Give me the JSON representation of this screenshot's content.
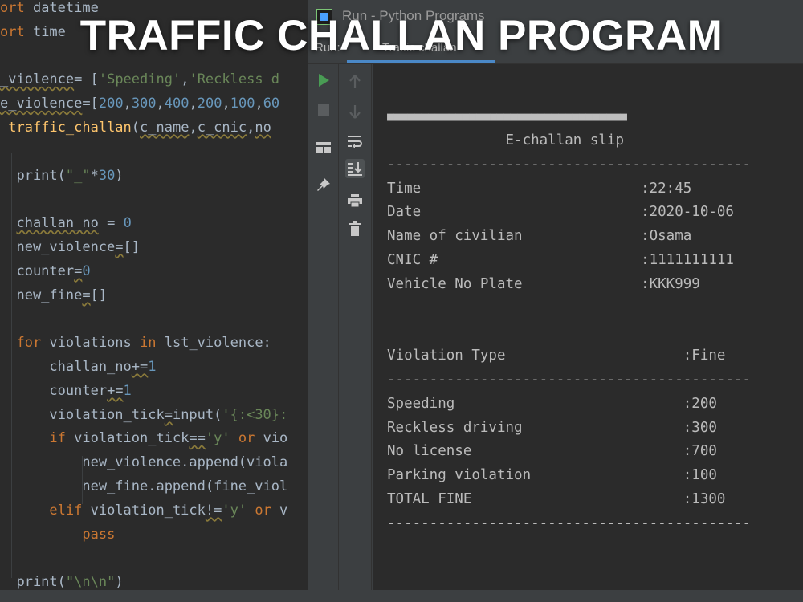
{
  "overlay": {
    "title": "TRAFFIC CHALLAN PROGRAM"
  },
  "run_window": {
    "title": "Run - Python Programs",
    "tabs": [
      {
        "label": "Run:"
      },
      {
        "label": "Traffic challan"
      }
    ]
  },
  "editor": {
    "lines": [
      [
        {
          "t": "ort ",
          "c": "kw"
        },
        {
          "t": "datetime",
          "c": ""
        }
      ],
      [
        {
          "t": "ort ",
          "c": "kw"
        },
        {
          "t": "time ",
          "c": ""
        }
      ],
      [],
      [
        {
          "t": "_violence",
          "c": "wavy"
        },
        {
          "t": "= [",
          "c": ""
        },
        {
          "t": "'Speeding'",
          "c": "str"
        },
        {
          "t": ",",
          "c": ""
        },
        {
          "t": "'Reckless d",
          "c": "str"
        }
      ],
      [
        {
          "t": "e_violence",
          "c": "wavy"
        },
        {
          "t": "=[",
          "c": ""
        },
        {
          "t": "200",
          "c": "num"
        },
        {
          "t": ",",
          "c": ""
        },
        {
          "t": "300",
          "c": "num"
        },
        {
          "t": ",",
          "c": ""
        },
        {
          "t": "400",
          "c": "num"
        },
        {
          "t": ",",
          "c": ""
        },
        {
          "t": "200",
          "c": "num"
        },
        {
          "t": ",",
          "c": ""
        },
        {
          "t": "100",
          "c": "num"
        },
        {
          "t": ",",
          "c": ""
        },
        {
          "t": "60",
          "c": "num"
        }
      ],
      [
        {
          "t": " ",
          "c": ""
        },
        {
          "t": "traffic_challan",
          "c": "fn"
        },
        {
          "t": "(",
          "c": ""
        },
        {
          "t": "c_name",
          "c": "wavy"
        },
        {
          "t": ",",
          "c": ""
        },
        {
          "t": "c_cnic",
          "c": "wavy"
        },
        {
          "t": ",",
          "c": ""
        },
        {
          "t": "no",
          "c": "wavy"
        }
      ],
      [],
      [
        {
          "t": "  print(",
          "c": ""
        },
        {
          "t": "\"_\"",
          "c": "str"
        },
        {
          "t": "*",
          "c": ""
        },
        {
          "t": "30",
          "c": "num"
        },
        {
          "t": ")",
          "c": ""
        }
      ],
      [],
      [
        {
          "t": "  ",
          "c": ""
        },
        {
          "t": "challan_no",
          "c": "wavy"
        },
        {
          "t": " = ",
          "c": ""
        },
        {
          "t": "0",
          "c": "num"
        }
      ],
      [
        {
          "t": "  new_violence",
          "c": ""
        },
        {
          "t": "=",
          "c": "wavy"
        },
        {
          "t": "[]",
          "c": ""
        }
      ],
      [
        {
          "t": "  counter",
          "c": ""
        },
        {
          "t": "=",
          "c": "wavy"
        },
        {
          "t": "0",
          "c": "num"
        }
      ],
      [
        {
          "t": "  new_fine",
          "c": ""
        },
        {
          "t": "=",
          "c": "wavy"
        },
        {
          "t": "[]",
          "c": ""
        }
      ],
      [],
      [
        {
          "t": "  for ",
          "c": "kw"
        },
        {
          "t": "violations ",
          "c": ""
        },
        {
          "t": "in ",
          "c": "kw"
        },
        {
          "t": "lst_violence:",
          "c": ""
        }
      ],
      [
        {
          "t": "      challan_no",
          "c": ""
        },
        {
          "t": "+=",
          "c": "wavy"
        },
        {
          "t": "1",
          "c": "num"
        }
      ],
      [
        {
          "t": "      counter",
          "c": ""
        },
        {
          "t": "+=",
          "c": "wavy"
        },
        {
          "t": "1",
          "c": "num"
        }
      ],
      [
        {
          "t": "      violation_tick",
          "c": ""
        },
        {
          "t": "=",
          "c": "wavy"
        },
        {
          "t": "input(",
          "c": ""
        },
        {
          "t": "'{:<30}:",
          "c": "str"
        }
      ],
      [
        {
          "t": "      if ",
          "c": "kw"
        },
        {
          "t": "violation_tick",
          "c": ""
        },
        {
          "t": "==",
          "c": "wavy"
        },
        {
          "t": "'y'",
          "c": "str"
        },
        {
          "t": " or ",
          "c": "kw"
        },
        {
          "t": "vio",
          "c": ""
        }
      ],
      [
        {
          "t": "          new_violence.append(viola",
          "c": ""
        }
      ],
      [
        {
          "t": "          new_fine.append(fine_viol",
          "c": ""
        }
      ],
      [
        {
          "t": "      elif ",
          "c": "kw"
        },
        {
          "t": "violation_tick",
          "c": ""
        },
        {
          "t": "!=",
          "c": "wavy"
        },
        {
          "t": "'y'",
          "c": "str"
        },
        {
          "t": " or ",
          "c": "kw"
        },
        {
          "t": "v",
          "c": ""
        }
      ],
      [
        {
          "t": "          ",
          "c": ""
        },
        {
          "t": "pass",
          "c": "kw"
        }
      ],
      [],
      [
        {
          "t": "  print(",
          "c": ""
        },
        {
          "t": "\"\\n\\n\"",
          "c": "str"
        },
        {
          "t": ")",
          "c": ""
        }
      ]
    ]
  },
  "console": {
    "lines": [
      "■■■■■■■■■■■■■■■■■■■■■■■■■■■■■■■■■■■",
      "              E-challan slip",
      "-------------------------------------------",
      "Time                          :22:45",
      "Date                          :2020-10-06",
      "Name of civilian              :Osama",
      "CNIC #                        :1111111111",
      "Vehicle No Plate              :KKK999",
      "",
      "",
      "Violation Type                     :Fine",
      "-------------------------------------------",
      "Speeding                           :200",
      "Reckless driving                   :300",
      "No license                         :700",
      "Parking violation                  :100",
      "TOTAL FINE                         :1300",
      "-------------------------------------------"
    ]
  },
  "icons": {
    "run": "play-icon",
    "stop": "stop-icon",
    "up": "arrow-up-icon",
    "down": "arrow-down-icon",
    "layout": "layout-icon",
    "pin": "pin-icon",
    "wrap": "soft-wrap-icon",
    "scroll": "scroll-to-end-icon",
    "print": "print-icon",
    "trash": "trash-icon"
  },
  "colors": {
    "play": "#499c54",
    "accent": "#4a88c7",
    "background": "#2b2b2b"
  }
}
